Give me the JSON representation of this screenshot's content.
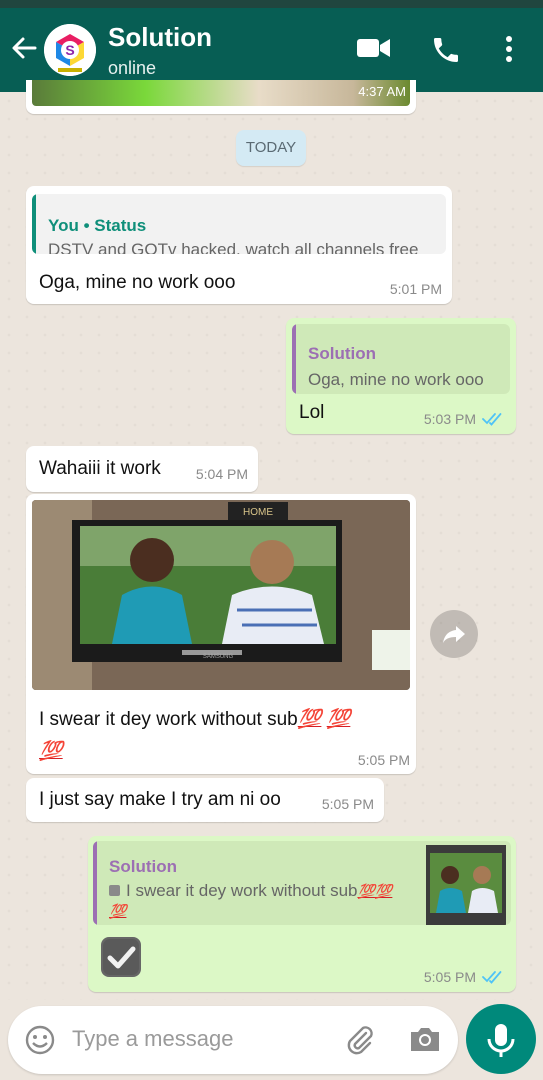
{
  "header": {
    "title": "Solution",
    "subtitle": "online",
    "avatar_letter": "S"
  },
  "top_media": {
    "time": "4:37 AM"
  },
  "date_chip": "TODAY",
  "messages": [
    {
      "dir": "in",
      "quote_name": "You • Status",
      "quote_text": "DSTV and GOTv hacked. watch all channels free",
      "text": "Oga,  mine no work ooo",
      "time": "5:01 PM"
    },
    {
      "dir": "out",
      "quote_name": "Solution",
      "quote_text": "Oga,  mine no work ooo",
      "text": "Lol",
      "time": "5:03 PM",
      "status": "read"
    },
    {
      "dir": "in",
      "text": "Wahaiii it work",
      "time": "5:04 PM"
    },
    {
      "dir": "in",
      "image_overlay_text": "HOME",
      "tv_brand": "SAMSUNG",
      "caption": "I swear it dey work without sub",
      "emoji_a": "💯",
      "emoji_b": "💯",
      "emoji_c": "💯",
      "time": "5:05 PM"
    },
    {
      "dir": "in",
      "text": "I just say make I try am ni oo",
      "time": "5:05 PM"
    },
    {
      "dir": "out",
      "quote_name": "Solution",
      "quote_text": "I swear it dey work without sub",
      "quote_emoji_a": "💯",
      "quote_emoji_b": "💯",
      "quote_emoji_c": "💯",
      "time": "5:05 PM",
      "status": "read"
    }
  ],
  "composer": {
    "placeholder": "Type a message"
  },
  "colors": {
    "header": "#075e54",
    "outgoing": "#dcf8c6",
    "incoming": "#ffffff",
    "accent": "#00897b",
    "read_ticks": "#4fc3f7"
  }
}
